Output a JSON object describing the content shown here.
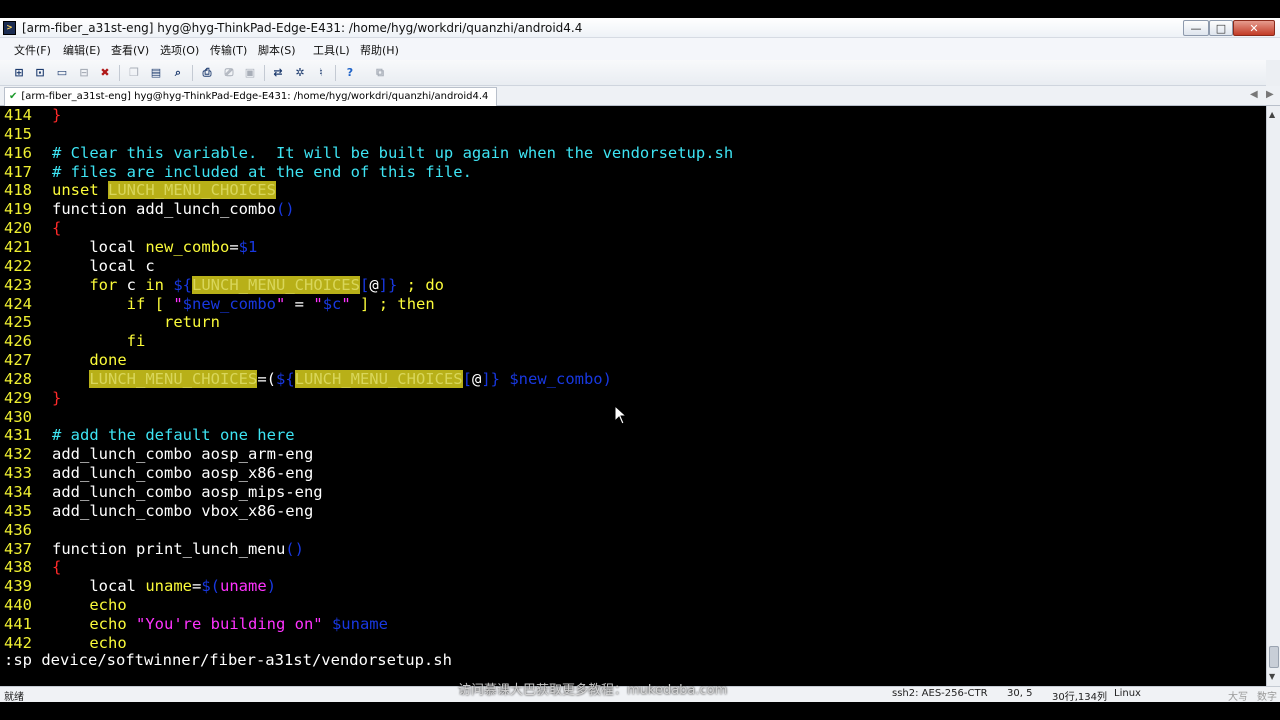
{
  "window": {
    "title": "[arm-fiber_a31st-eng] hyg@hyg-ThinkPad-Edge-E431: /home/hyg/workdri/quanzhi/android4.4",
    "min": "—",
    "max": "□",
    "close": "✕"
  },
  "menu": [
    "文件(F)",
    "编辑(E)",
    "查看(V)",
    "选项(O)",
    "传输(T)",
    "脚本(S)",
    "工具(L)",
    "帮助(H)"
  ],
  "toolbar_icons": [
    "new-session-icon",
    "open-session-icon",
    "reconnect-icon",
    "disconnect-icon",
    "close-session-icon",
    "copy-icon",
    "paste-icon",
    "find-icon",
    "print-icon",
    "print-setup-icon",
    "print-screen-icon",
    "sftp-icon",
    "settings-icon",
    "keymap-icon",
    "help-icon",
    "screenshot-icon"
  ],
  "tab": {
    "label": "[arm-fiber_a31st-eng] hyg@hyg-ThinkPad-Edge-E431: /home/hyg/workdri/quanzhi/android4.4",
    "check": "✔"
  },
  "terminal": {
    "lines": [
      {
        "n": "414",
        "segs": [
          [
            "brk",
            "}"
          ]
        ]
      },
      {
        "n": "415",
        "segs": []
      },
      {
        "n": "416",
        "segs": [
          [
            "cmt",
            "# Clear this variable.  It will be built up again when the vendorsetup.sh"
          ]
        ]
      },
      {
        "n": "417",
        "segs": [
          [
            "cmt",
            "# files are included at the end of this file."
          ]
        ]
      },
      {
        "n": "418",
        "segs": [
          [
            "kw",
            "unset "
          ],
          [
            "hl",
            "LUNCH_MENU_CHOICES"
          ]
        ]
      },
      {
        "n": "419",
        "segs": [
          [
            "sel",
            "function add_lunch_combo"
          ],
          [
            "var",
            "()"
          ]
        ]
      },
      {
        "n": "420",
        "segs": [
          [
            "brk",
            "{"
          ]
        ]
      },
      {
        "n": "421",
        "segs": [
          [
            "sel",
            "    local "
          ],
          [
            "kw",
            "new_combo"
          ],
          [
            "sel",
            "="
          ],
          [
            "var",
            "$1"
          ]
        ]
      },
      {
        "n": "422",
        "segs": [
          [
            "sel",
            "    local c"
          ]
        ]
      },
      {
        "n": "423",
        "segs": [
          [
            "kw",
            "    for "
          ],
          [
            "sel",
            "c "
          ],
          [
            "kw",
            "in "
          ],
          [
            "var",
            "${"
          ],
          [
            "hl",
            "LUNCH_MENU_CHOICES"
          ],
          [
            "var",
            "["
          ],
          [
            "sel",
            "@"
          ],
          [
            "var",
            "]}"
          ],
          [
            "kw",
            " ; do"
          ]
        ]
      },
      {
        "n": "424",
        "segs": [
          [
            "kw",
            "        if [ "
          ],
          [
            "str",
            "\""
          ],
          [
            "var",
            "$new_combo"
          ],
          [
            "str",
            "\""
          ],
          [
            "sel",
            " = "
          ],
          [
            "str",
            "\""
          ],
          [
            "var",
            "$c"
          ],
          [
            "str",
            "\""
          ],
          [
            "kw",
            " ] ; then"
          ]
        ]
      },
      {
        "n": "425",
        "segs": [
          [
            "kw",
            "            return"
          ]
        ]
      },
      {
        "n": "426",
        "segs": [
          [
            "kw",
            "        fi"
          ]
        ]
      },
      {
        "n": "427",
        "segs": [
          [
            "kw",
            "    done"
          ]
        ]
      },
      {
        "n": "428",
        "segs": [
          [
            "sel",
            "    "
          ],
          [
            "hl",
            "LUNCH_MENU_CHOICES"
          ],
          [
            "sel",
            "=("
          ],
          [
            "var",
            "${"
          ],
          [
            "hl",
            "LUNCH_MENU_CHOICES"
          ],
          [
            "var",
            "["
          ],
          [
            "sel",
            "@"
          ],
          [
            "var",
            "]} $new_combo)"
          ]
        ]
      },
      {
        "n": "429",
        "segs": [
          [
            "brk",
            "}"
          ]
        ]
      },
      {
        "n": "430",
        "segs": []
      },
      {
        "n": "431",
        "segs": [
          [
            "cmt",
            "# add the default one here"
          ]
        ]
      },
      {
        "n": "432",
        "segs": [
          [
            "sel",
            "add_lunch_combo aosp_arm-eng"
          ]
        ]
      },
      {
        "n": "433",
        "segs": [
          [
            "sel",
            "add_lunch_combo aosp_x86-eng"
          ]
        ]
      },
      {
        "n": "434",
        "segs": [
          [
            "sel",
            "add_lunch_combo aosp_mips-eng"
          ]
        ]
      },
      {
        "n": "435",
        "segs": [
          [
            "sel",
            "add_lunch_combo vbox_x86-eng"
          ]
        ]
      },
      {
        "n": "436",
        "segs": []
      },
      {
        "n": "437",
        "segs": [
          [
            "sel",
            "function print_lunch_menu"
          ],
          [
            "var",
            "()"
          ]
        ]
      },
      {
        "n": "438",
        "segs": [
          [
            "brk",
            "{"
          ]
        ]
      },
      {
        "n": "439",
        "segs": [
          [
            "sel",
            "    local "
          ],
          [
            "kw",
            "uname"
          ],
          [
            "sel",
            "="
          ],
          [
            "var",
            "$("
          ],
          [
            "str",
            "uname"
          ],
          [
            "var",
            ")"
          ]
        ]
      },
      {
        "n": "440",
        "segs": [
          [
            "kw",
            "    echo"
          ]
        ]
      },
      {
        "n": "441",
        "segs": [
          [
            "kw",
            "    echo "
          ],
          [
            "str",
            "\"You're building on\" "
          ],
          [
            "var",
            "$uname"
          ]
        ]
      },
      {
        "n": "442",
        "segs": [
          [
            "kw",
            "    echo"
          ]
        ]
      }
    ],
    "cmdline": ":sp device/softwinner/fiber-a31st/vendorsetup.sh"
  },
  "status": {
    "ready": "就绪",
    "cipher": "ssh2: AES-256-CTR",
    "cursor_pos": "30,  5",
    "size": "30行,134列",
    "os": "Linux",
    "caps": "大写",
    "num": "数字"
  },
  "watermark": "访问慕课大巴获取更多教程：mukedaba.com"
}
